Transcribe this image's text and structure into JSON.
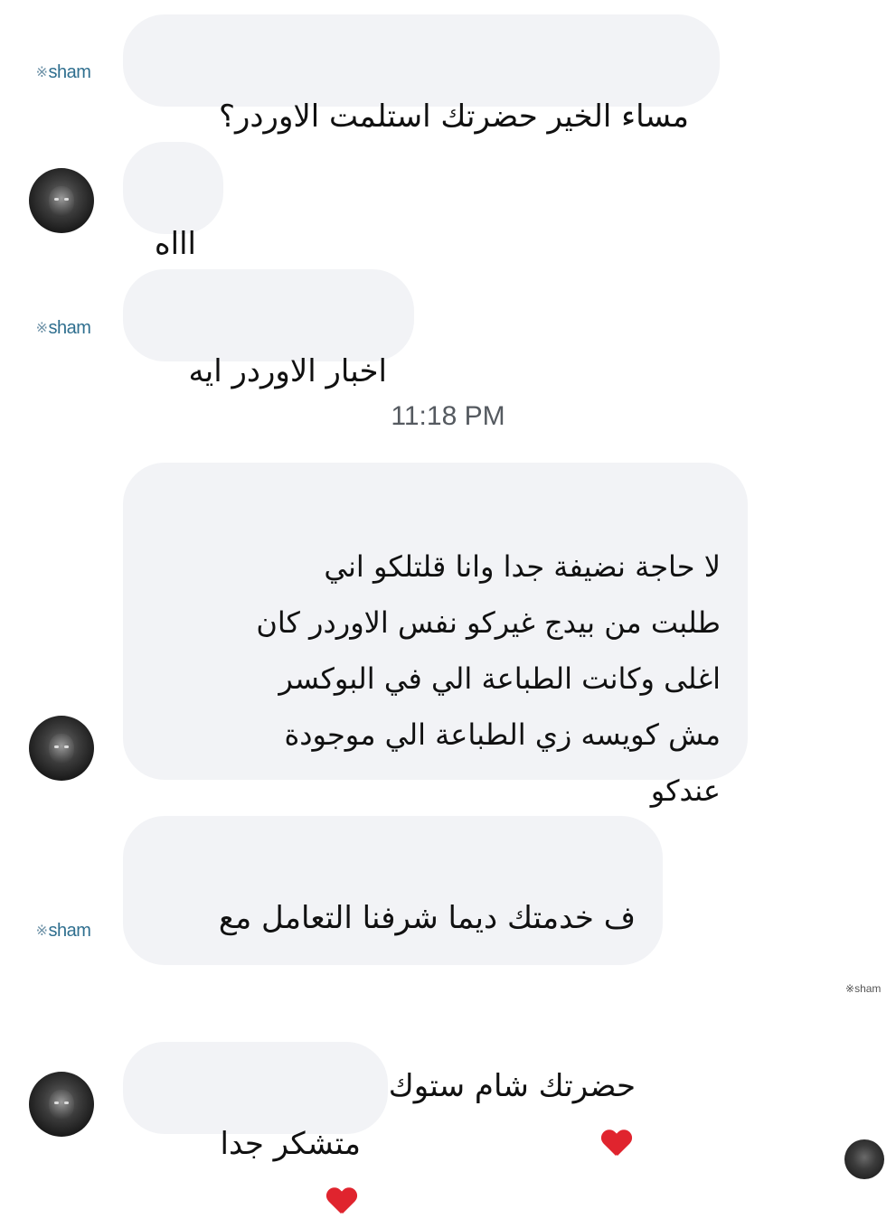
{
  "conversation": {
    "messages": [
      {
        "sender": "sham",
        "text": "مساء الخير حضرتك استلمت الاوردر؟"
      },
      {
        "sender": "customer",
        "text": "اااه"
      },
      {
        "sender": "sham",
        "text": "اخبار الاوردر ايه"
      },
      {
        "sender": "customer",
        "text": "لا حاجة نضيفة جدا وانا قلتلكو اني\nطلبت من بيدج غيركو نفس الاوردر كان\nاغلى وكانت الطباعة الي في البوكسر\nمش كويسه زي الطباعة الي موجودة\nعندكو"
      },
      {
        "sender": "sham",
        "text_line1": "ف خدمتك ديما شرفنا التعامل مع",
        "text_line2": "حضرتك شام ستوك",
        "emoji": "red-heart"
      },
      {
        "sender": "customer",
        "text": "متشكر جدا",
        "emoji": "red-heart"
      }
    ],
    "timestamp": "11:18 PM"
  },
  "avatars": {
    "sham_label": "sham",
    "sham_mark": "※"
  },
  "seen_indicators": {
    "sham_label": "sham",
    "sham_mark": "※"
  },
  "colors": {
    "bubble_bg": "#f2f3f6",
    "heart": "#e0242e",
    "timestamp": "#555a60"
  }
}
